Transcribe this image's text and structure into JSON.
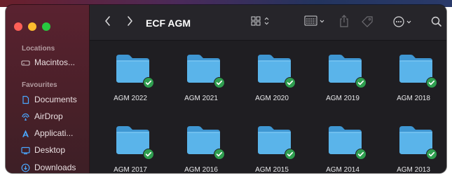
{
  "window": {
    "title": "ECF AGM"
  },
  "sidebar": {
    "sections": [
      {
        "label": "Locations",
        "items": [
          {
            "label": "Macintos...",
            "icon": "disk-icon"
          }
        ]
      },
      {
        "label": "Favourites",
        "items": [
          {
            "label": "Documents",
            "icon": "document-icon"
          },
          {
            "label": "AirDrop",
            "icon": "airdrop-icon"
          },
          {
            "label": "Applicati...",
            "icon": "applications-icon"
          },
          {
            "label": "Desktop",
            "icon": "desktop-icon"
          },
          {
            "label": "Downloads",
            "icon": "downloads-icon"
          }
        ]
      }
    ]
  },
  "toolbar": {
    "back_icon": "chevron-left-icon",
    "forward_icon": "chevron-right-icon",
    "view_icon": "grid-view-icon",
    "group_icon": "group-icon",
    "share_icon": "share-icon",
    "tag_icon": "tag-icon",
    "more_icon": "more-icon",
    "search_icon": "search-icon"
  },
  "folders": [
    {
      "label": "AGM 2022",
      "synced": true
    },
    {
      "label": "AGM 2021",
      "synced": true
    },
    {
      "label": "AGM 2020",
      "synced": true
    },
    {
      "label": "AGM 2019",
      "synced": true
    },
    {
      "label": "AGM 2018",
      "synced": true
    },
    {
      "label": "AGM 2017",
      "synced": true
    },
    {
      "label": "AGM 2016",
      "synced": true
    },
    {
      "label": "AGM 2015",
      "synced": true
    },
    {
      "label": "AGM 2014",
      "synced": true
    },
    {
      "label": "AGM 2013",
      "synced": true
    }
  ],
  "colors": {
    "folder": "#5ab4ea",
    "sync_badge": "#2f9e4f",
    "traffic_red": "#fe5f57",
    "traffic_yellow": "#febc2e",
    "traffic_green": "#28c840"
  }
}
